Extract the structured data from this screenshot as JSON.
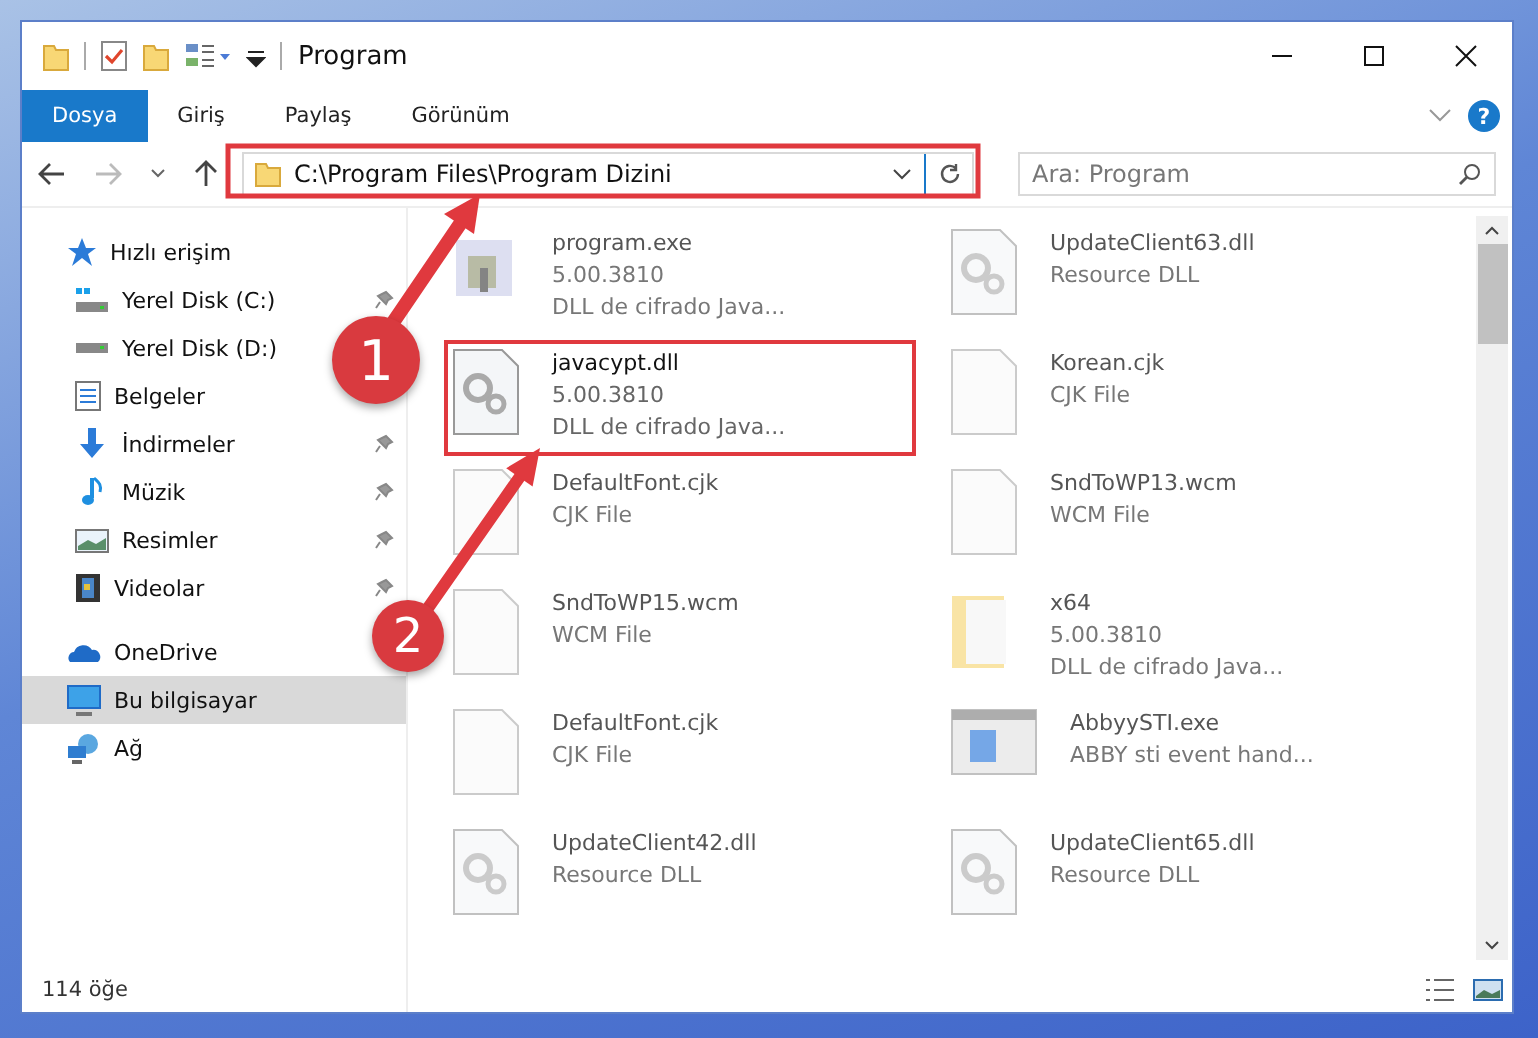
{
  "window": {
    "title": "Program",
    "quick_access_toolbar": [
      {
        "kind": "folder"
      },
      {
        "kind": "properties"
      },
      {
        "kind": "folder"
      },
      {
        "kind": "view"
      },
      {
        "kind": "customize"
      }
    ],
    "controls": [
      {
        "kind": "minimize"
      },
      {
        "kind": "maximize"
      },
      {
        "kind": "close"
      }
    ]
  },
  "ribbon": {
    "tabs": [
      {
        "label": "Dosya",
        "selected": true
      },
      {
        "label": "Giriş",
        "selected": false
      },
      {
        "label": "Paylaş",
        "selected": false
      },
      {
        "label": "Görünüm",
        "selected": false
      }
    ],
    "help": "?"
  },
  "address_bar": {
    "path": "C:\\Program Files\\Program Dizini",
    "highlighted": true
  },
  "search": {
    "placeholder": "Ara: Program"
  },
  "sidebar": {
    "items": [
      {
        "label": "Hızlı erişim",
        "kind": "star",
        "selected": false,
        "children": [
          {
            "label": "Yerel Disk (C:)",
            "kind": "drive-c",
            "pinned": true
          },
          {
            "label": "Yerel Disk (D:)",
            "kind": "drive",
            "pinned": false
          },
          {
            "label": "Belgeler",
            "kind": "document",
            "pinned": false
          },
          {
            "label": "İndirmeler",
            "kind": "download",
            "pinned": true
          },
          {
            "label": "Müzik",
            "kind": "music",
            "pinned": true
          },
          {
            "label": "Resimler",
            "kind": "pictures",
            "pinned": true
          },
          {
            "label": "Videolar",
            "kind": "video",
            "pinned": true
          }
        ]
      },
      {
        "label": "OneDrive",
        "kind": "cloud",
        "selected": false
      },
      {
        "label": "Bu bilgisayar",
        "kind": "computer",
        "selected": true
      },
      {
        "label": "Ağ",
        "kind": "network",
        "selected": false
      }
    ]
  },
  "files": [
    {
      "kind": "program",
      "lines": [
        "program.exe",
        "5.00.3810",
        "DLL de cifrado Java..."
      ],
      "blurred": true,
      "highlighted": false
    },
    {
      "kind": "dll",
      "lines": [
        "UpdateClient63.dll",
        "Resource DLL"
      ],
      "blurred": true,
      "highlighted": false
    },
    {
      "kind": "dll",
      "lines": [
        "javacypt.dll",
        "5.00.3810",
        "DLL de cifrado Java..."
      ],
      "blurred": false,
      "highlighted": true
    },
    {
      "kind": "file",
      "lines": [
        "Korean.cjk",
        "CJK File"
      ],
      "blurred": true,
      "highlighted": false
    },
    {
      "kind": "file",
      "lines": [
        "DefaultFont.cjk",
        "CJK File"
      ],
      "blurred": true,
      "highlighted": false
    },
    {
      "kind": "file",
      "lines": [
        "SndToWP13.wcm",
        "WCM File"
      ],
      "blurred": true,
      "highlighted": false
    },
    {
      "kind": "file",
      "lines": [
        "SndToWP15.wcm",
        "WCM File"
      ],
      "blurred": true,
      "highlighted": false
    },
    {
      "kind": "folder",
      "lines": [
        "x64",
        "5.00.3810",
        "DLL de cifrado Java..."
      ],
      "blurred": true,
      "highlighted": false
    },
    {
      "kind": "file",
      "lines": [
        "DefaultFont.cjk",
        "CJK File"
      ],
      "blurred": true,
      "highlighted": false
    },
    {
      "kind": "window",
      "lines": [
        "AbbyySTI.exe",
        "ABBY sti event hand..."
      ],
      "blurred": true,
      "highlighted": false
    },
    {
      "kind": "dll",
      "lines": [
        "UpdateClient42.dll",
        "Resource DLL"
      ],
      "blurred": true,
      "highlighted": false
    },
    {
      "kind": "dll",
      "lines": [
        "UpdateClient65.dll",
        "Resource DLL"
      ],
      "blurred": true,
      "highlighted": false
    }
  ],
  "status_bar": {
    "count": "114 öğe"
  },
  "annotations": [
    {
      "number": "1"
    },
    {
      "number": "2"
    }
  ]
}
